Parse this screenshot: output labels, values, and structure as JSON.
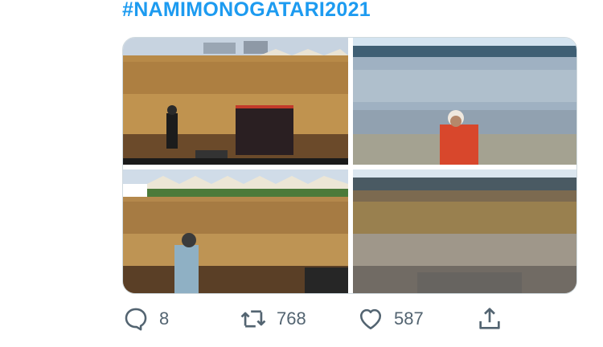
{
  "tweet": {
    "hashtag": "#NAMIMONOGATARI2021",
    "media": [
      {
        "icon": "concert-crowd-photo-1",
        "description": ""
      },
      {
        "icon": "concert-crowd-photo-2",
        "description": ""
      },
      {
        "icon": "concert-crowd-photo-3",
        "description": ""
      },
      {
        "icon": "concert-crowd-photo-4",
        "description": ""
      }
    ],
    "actions": {
      "replies": "8",
      "retweets": "768",
      "likes": "587"
    }
  },
  "colors": {
    "link": "#1d9bf0",
    "icon_gray": "#536471"
  }
}
